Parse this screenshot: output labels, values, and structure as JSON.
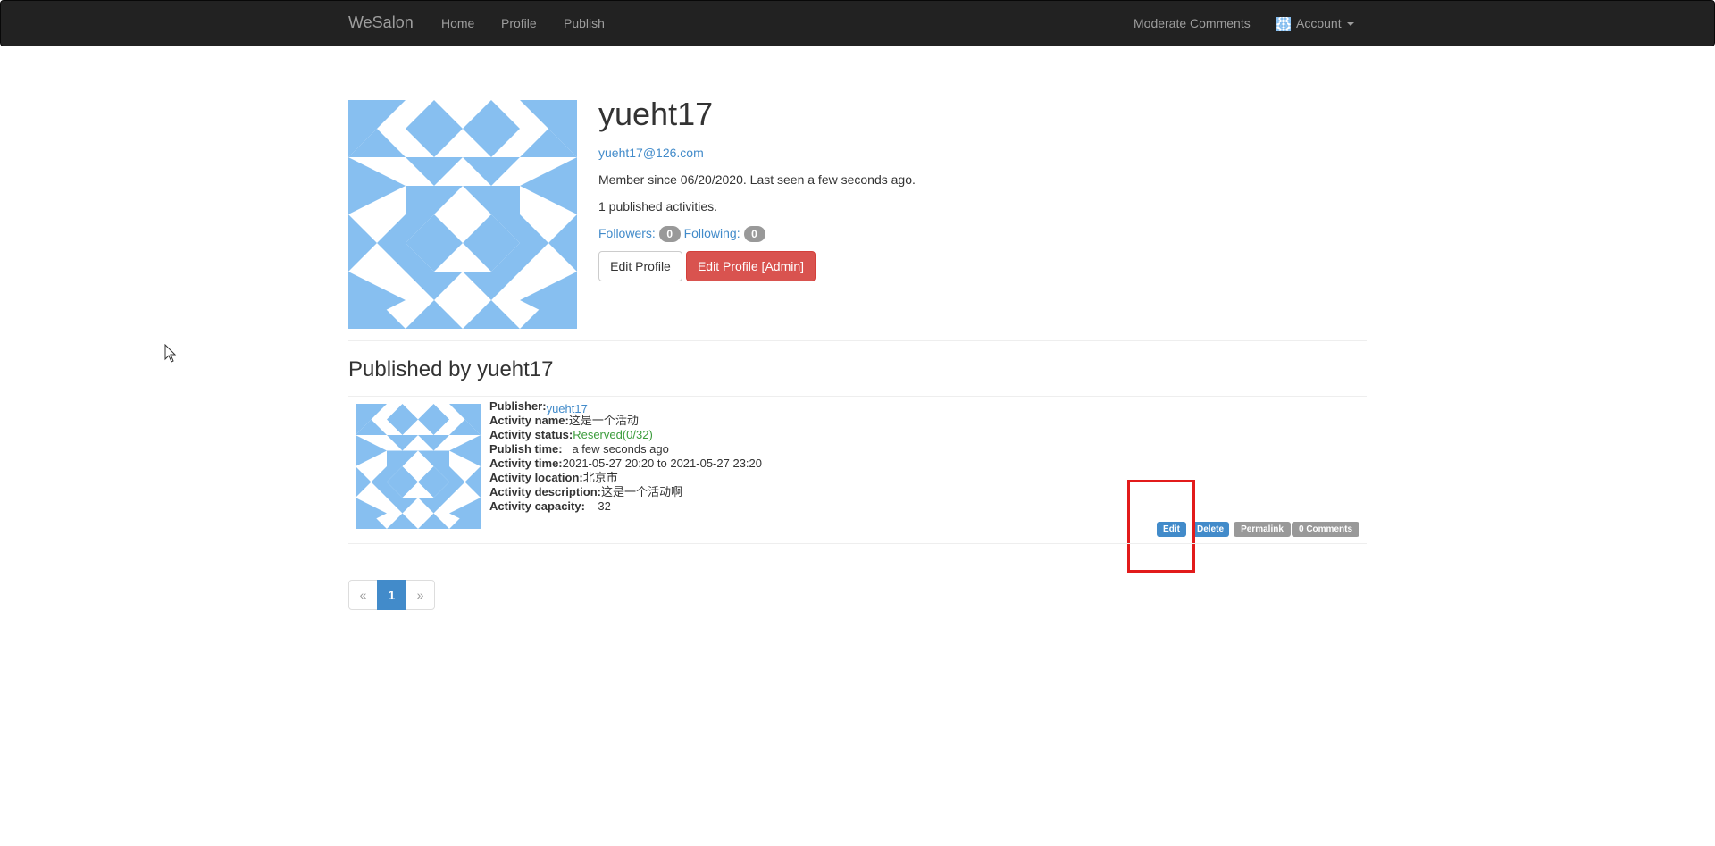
{
  "navbar": {
    "brand": "WeSalon",
    "links": [
      {
        "label": "Home"
      },
      {
        "label": "Profile"
      },
      {
        "label": "Publish"
      }
    ],
    "moderate": "Moderate Comments",
    "account": "Account"
  },
  "profile": {
    "username": "yueht17",
    "email": "yueht17@126.com",
    "member_line": "Member since 06/20/2020. Last seen a few seconds ago.",
    "published_line": "1 published activities.",
    "followers_label": "Followers:",
    "followers_count": "0",
    "following_label": "Following:",
    "following_count": "0",
    "edit_button": "Edit Profile",
    "edit_admin_button": "Edit Profile [Admin]"
  },
  "section": {
    "title": "Published by yueht17"
  },
  "post": {
    "publisher_label": "Publisher:",
    "publisher": "yueht17",
    "name_label": "Activity name:",
    "name": "这是一个活动",
    "status_label": "Activity status:",
    "status": "Reserved(0/32)",
    "publish_time_label": "Publish time:",
    "publish_time": "a few seconds ago",
    "activity_time_label": "Activity time:",
    "activity_time": "2021-05-27 20:20 to 2021-05-27 23:20",
    "location_label": "Activity location:",
    "location": "北京市",
    "description_label": "Activity description:",
    "description": "这是一个活动啊",
    "capacity_label": "Activity capacity:",
    "capacity": "32",
    "actions": {
      "edit": "Edit",
      "delete": "Delete",
      "permalink": "Permalink",
      "comments": "0 Comments"
    }
  },
  "pagination": {
    "prev": "«",
    "current": "1",
    "next": "»"
  },
  "colors": {
    "navbar_bg": "#222222",
    "link": "#428bca",
    "danger": "#d9534f",
    "identicon": "#87bff0",
    "highlight": "#e21b1b",
    "status_ok": "#3c9c3c"
  },
  "icons": {
    "cursor": "mouse-pointer-icon",
    "caret": "caret-down-icon"
  }
}
